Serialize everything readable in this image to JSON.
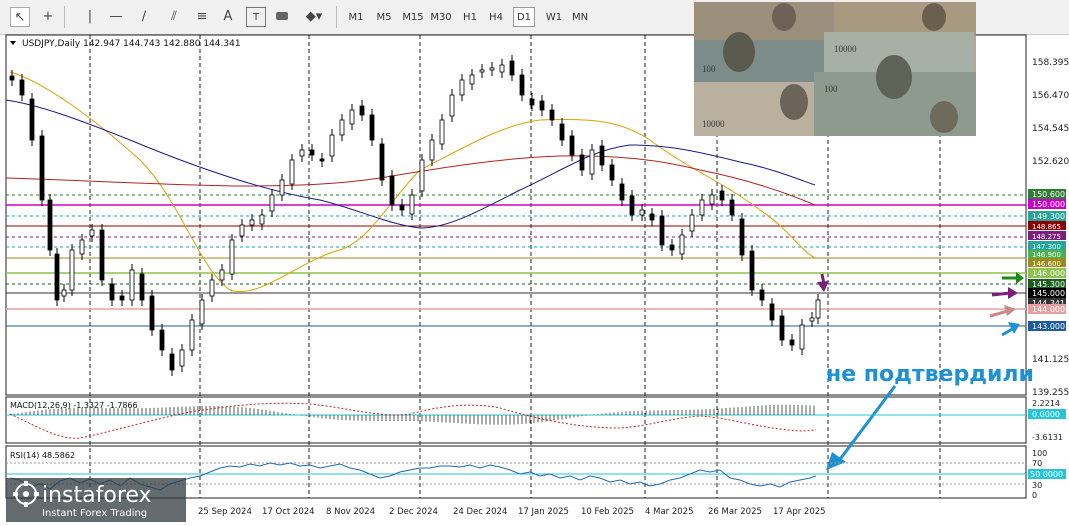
{
  "toolbar": {
    "timeframes": [
      {
        "label": "M1"
      },
      {
        "label": "M5"
      },
      {
        "label": "M15"
      },
      {
        "label": "M30"
      },
      {
        "label": "H1"
      },
      {
        "label": "H4"
      },
      {
        "label": "D1",
        "active": true
      },
      {
        "label": "W1"
      },
      {
        "label": "MN"
      }
    ],
    "tools": [
      "cursor-icon",
      "crosshair-icon",
      "vertical-line-icon",
      "horizontal-line-icon",
      "trend-line-icon",
      "channel-icon",
      "fibonacci-icon",
      "text-tool-icon",
      "text-label-icon",
      "rectangle-icon",
      "shapes-icon"
    ]
  },
  "main_chart": {
    "header": "USDJPY,Daily  142.947 144.743 142.880 144.341",
    "price_ticks": [
      "158.395",
      "156.470",
      "154.545",
      "152.620",
      "141.125",
      "139.255"
    ],
    "levels": [
      {
        "label": "150.600",
        "color": "#2e7d32"
      },
      {
        "label": "150.000",
        "color": "#cc00cc"
      },
      {
        "label": "149.300",
        "color": "#26a69a"
      },
      {
        "label": "148.865",
        "color": "#8b0000"
      },
      {
        "label": "148.275",
        "color": "#7a1f7a"
      },
      {
        "label": "147.300",
        "color": "#26a69a"
      },
      {
        "label": "146.900",
        "color": "#4caf50"
      },
      {
        "label": "146.600",
        "color": "#9a8c1a"
      },
      {
        "label": "146.000",
        "color": "#8bc34a"
      },
      {
        "label": "145.300",
        "color": "#1b5e20"
      },
      {
        "label": "145.000",
        "color": "#000000"
      },
      {
        "label": "144.341",
        "color": "#333333"
      },
      {
        "label": "144.000",
        "color": "#e6a0a0"
      },
      {
        "label": "143.000",
        "color": "#1e5b9a"
      }
    ],
    "annotation": "не подтвердили"
  },
  "date_axis": [
    "25 Sep 2024",
    "17 Oct 2024",
    "8 Nov 2024",
    "2 Dec 2024",
    "24 Dec 2024",
    "17 Jan 2025",
    "10 Feb 2025",
    "4 Mar 2025",
    "26 Mar 2025",
    "17 Apr 2025"
  ],
  "macd": {
    "header": "MACD(12,26,9) -1.3327 -1.7866",
    "ticks": [
      "2.2214",
      "0.0000",
      "-3.6131"
    ]
  },
  "rsi": {
    "header": "RSI(14) 48.5862",
    "ticks": [
      "100",
      "70",
      "50.0000",
      "30",
      "0"
    ]
  },
  "watermark": {
    "brand": "instaforex",
    "tagline": "Instant Forex Trading"
  },
  "colors": {
    "bull": "#ffffff",
    "bear": "#000000",
    "ma_fast": "#e0a100",
    "ma_mid": "#b22222",
    "ma_slow": "#1a1a8c",
    "annotation": "#1e90d6"
  }
}
